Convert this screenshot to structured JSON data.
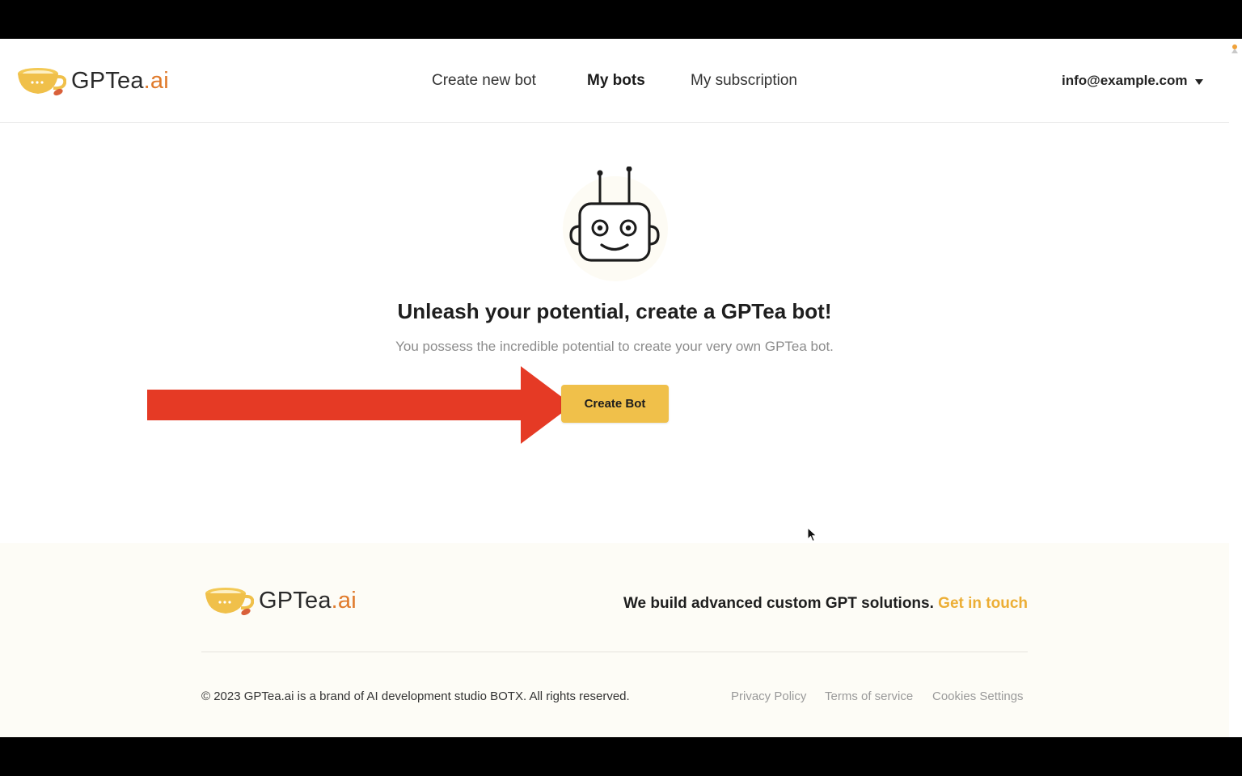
{
  "brand": {
    "name_main": "GPTea",
    "name_suffix": ".ai",
    "accent_color": "#f0c04a",
    "suffix_color": "#e07a2b"
  },
  "nav": {
    "items": [
      {
        "label": "Create new bot",
        "active": false
      },
      {
        "label": "My bots",
        "active": true
      },
      {
        "label": "My subscription",
        "active": false
      }
    ]
  },
  "account": {
    "email": "info@example.com",
    "icon": "caret-down-icon"
  },
  "main": {
    "illustration": "robot-icon",
    "headline": "Unleash your potential, create a GPTea bot!",
    "subline": "You possess the incredible potential to create your very own GPTea bot.",
    "create_button_label": "Create Bot",
    "annotation": {
      "icon": "red-arrow-icon",
      "color": "#e53a25"
    }
  },
  "footer": {
    "tagline": "We build advanced custom GPT solutions.",
    "cta": "Get in touch",
    "copyright": "© 2023 GPTea.ai is a brand of AI development studio BOTX. All rights reserved.",
    "links": [
      "Privacy Policy",
      "Terms of service",
      "Cookies Settings"
    ]
  }
}
